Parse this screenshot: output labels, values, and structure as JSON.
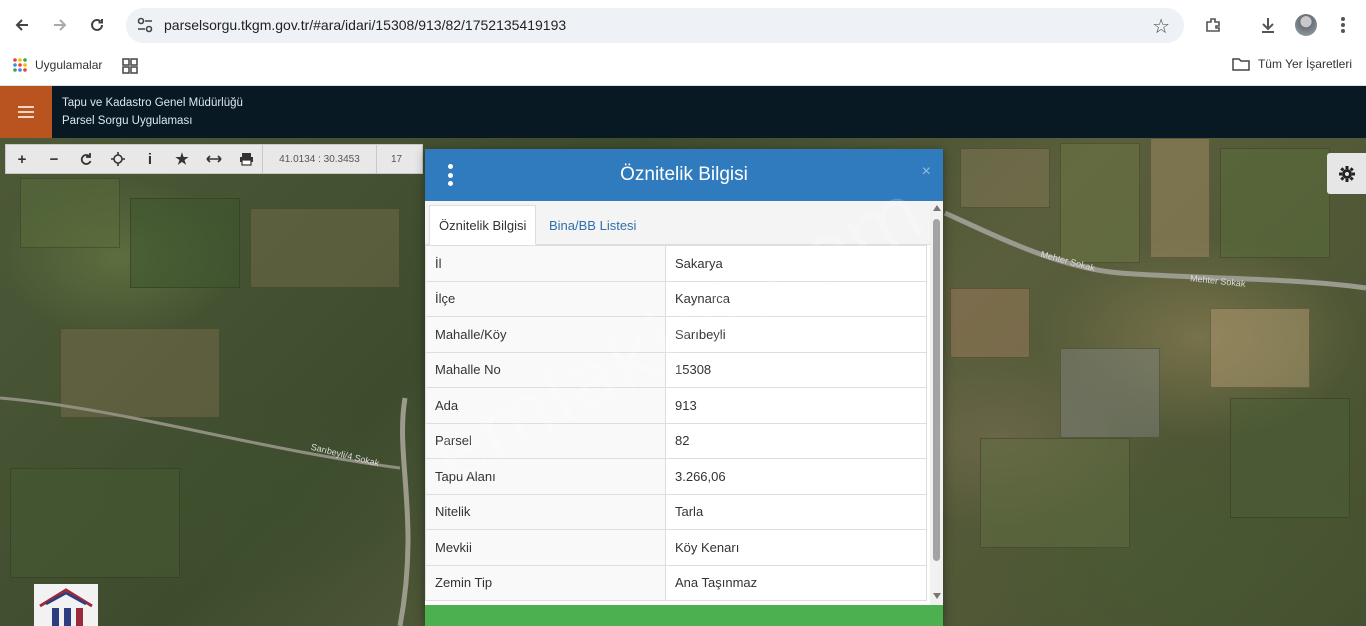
{
  "browser": {
    "url": "parselsorgu.tkgm.gov.tr/#ara/idari/15308/913/82/1752135419193",
    "bookmarks": {
      "apps_label": "Uygulamalar",
      "all_bookmarks_label": "Tüm Yer İşaretleri"
    }
  },
  "header": {
    "org_name": "Tapu ve Kadastro Genel Müdürlüğü",
    "app_name": "Parsel Sorgu Uygulaması"
  },
  "toolbar": {
    "coordinates": "41.0134 : 30.3453",
    "zoom": "17"
  },
  "map": {
    "street_labels": [
      "Mehter Sokak",
      "Mehter Sokak",
      "Sarıbeyli/4 Sokak"
    ]
  },
  "dialog": {
    "title": "Öznitelik Bilgisi",
    "close": "×",
    "tabs": [
      {
        "label": "Öznitelik Bilgisi",
        "active": true
      },
      {
        "label": "Bina/BB Listesi",
        "active": false
      }
    ],
    "attributes": [
      {
        "key": "İl",
        "value": "Sakarya"
      },
      {
        "key": "İlçe",
        "value": "Kaynarca"
      },
      {
        "key": "Mahalle/Köy",
        "value": "Sarıbeyli"
      },
      {
        "key": "Mahalle No",
        "value": "15308"
      },
      {
        "key": "Ada",
        "value": "913"
      },
      {
        "key": "Parsel",
        "value": "82"
      },
      {
        "key": "Tapu Alanı",
        "value": "3.266,06"
      },
      {
        "key": "Nitelik",
        "value": "Tarla"
      },
      {
        "key": "Mevkii",
        "value": "Köy Kenarı"
      },
      {
        "key": "Zemin Tip",
        "value": "Ana Taşınmaz"
      }
    ]
  },
  "watermark": "emlakjet.com",
  "colors": {
    "header_bg": "#081923",
    "menu_accent": "#b9531f",
    "dialog_header": "#2f7bbd",
    "footer_button": "#4caf50"
  }
}
